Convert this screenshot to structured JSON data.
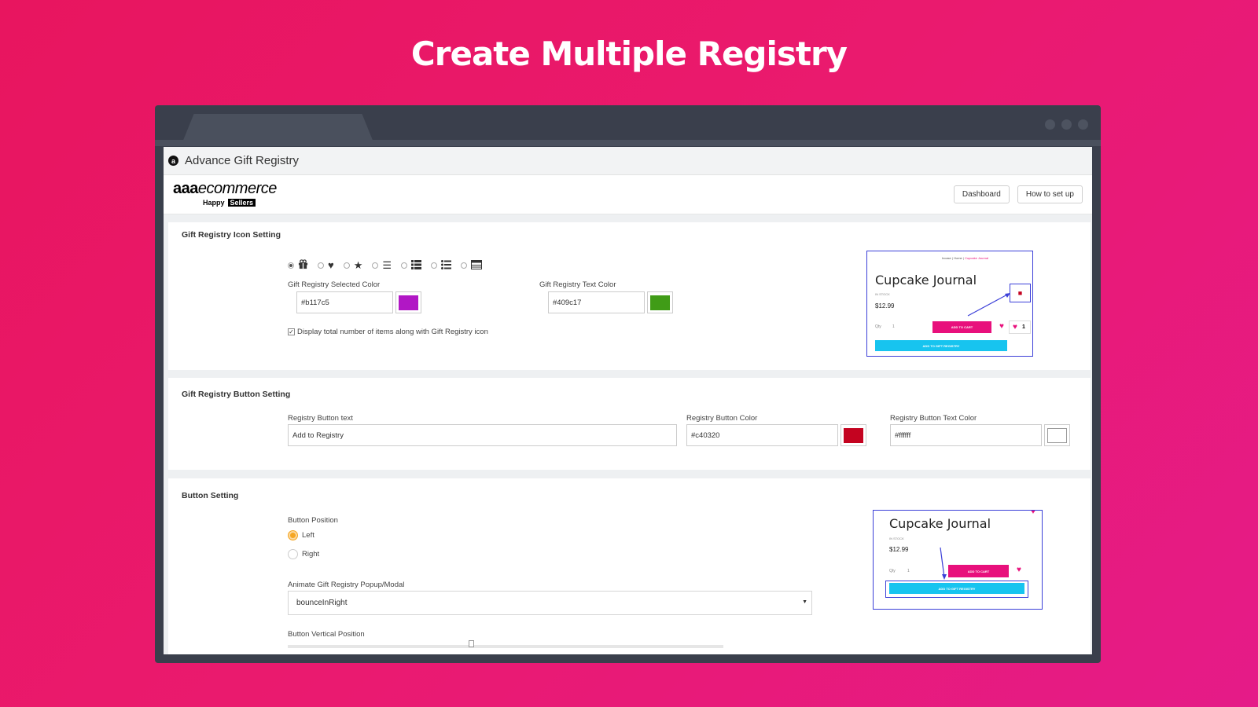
{
  "headline": "Create Multiple Registry",
  "window": {
    "title": "Advance Gift Registry",
    "app_icon": "a"
  },
  "brand": {
    "logo_bold": "aaa",
    "logo_italic": "ecommerce",
    "tag_happy": "Happy",
    "tag_sellers": "Sellers"
  },
  "nav": {
    "dashboard": "Dashboard",
    "how_to": "How to set up"
  },
  "icon_section": {
    "title": "Gift Registry Icon Setting",
    "icons": [
      "gift-icon",
      "heart-icon",
      "star-icon",
      "list-icon",
      "list-bold-icon",
      "bullet-list-icon",
      "table-icon"
    ],
    "selected_color_label": "Gift Registry Selected Color",
    "selected_color_value": "#b117c5",
    "selected_color": "#b117c5",
    "text_color_label": "Gift Registry Text Color",
    "text_color_value": "#409c17",
    "text_color": "#409c17",
    "display_total_label": "Display total number of items along with Gift Registry icon"
  },
  "button_section": {
    "title": "Gift Registry Button Setting",
    "button_text_label": "Registry Button text",
    "button_text_value": "Add to Registry",
    "button_color_label": "Registry Button Color",
    "button_color_value": "#c40320",
    "button_color": "#c40320",
    "button_text_color_label": "Registry Button Text Color",
    "button_text_color_value": "#ffffff",
    "button_text_color": "#ffffff"
  },
  "position_section": {
    "title": "Button Setting",
    "position_label": "Button Position",
    "left_label": "Left",
    "right_label": "Right",
    "animate_label": "Animate Gift Registry Popup/Modal",
    "animate_value": "bounceInRight",
    "vertical_label": "Button Vertical Position"
  },
  "preview1": {
    "crumb_1": "Incase",
    "crumb_sep": "|",
    "crumb_2": "Home",
    "crumb_3": "Cupcake Journal",
    "title": "Cupcake Journal",
    "stock": "IN STOCK",
    "price": "$12.99",
    "qty_label": "Qty",
    "qty_value": "1",
    "cart_button": "ADD TO CART",
    "registry_button": "ADD TO GIFT REGISTRY",
    "count": "1"
  },
  "preview2": {
    "title": "Cupcake Journal",
    "stock": "IN STOCK",
    "price": "$12.99",
    "qty_label": "Qty",
    "qty_value": "1",
    "cart_button": "ADD TO CART",
    "registry_button": "ADD TO GIFT REGISTRY"
  }
}
